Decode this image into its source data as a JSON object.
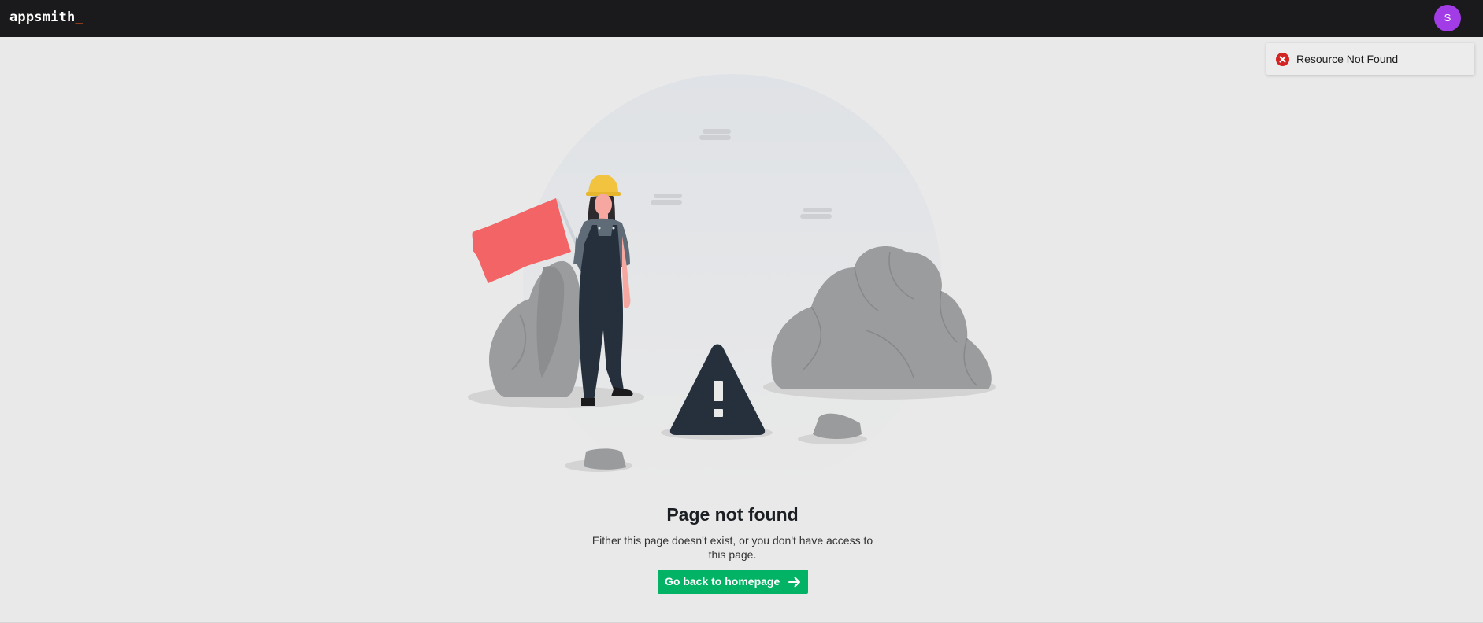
{
  "header": {
    "logo_text": "appsmith",
    "logo_cursor": "_",
    "avatar_initial": "S"
  },
  "toast": {
    "icon": "error-circle-icon",
    "message": "Resource Not Found"
  },
  "illustration": {
    "description_name": "construction-worker-404-illustration"
  },
  "main": {
    "title": "Page not found",
    "description": "Either this page doesn't exist, or you don't have access to this page.",
    "button_label": "Go back to homepage",
    "button_icon": "arrow-right-icon"
  },
  "colors": {
    "topbar": "#1a1a1c",
    "avatar": "#a23ce6",
    "button": "#03b365",
    "error": "#d32323",
    "logo_cursor": "#e15615"
  }
}
